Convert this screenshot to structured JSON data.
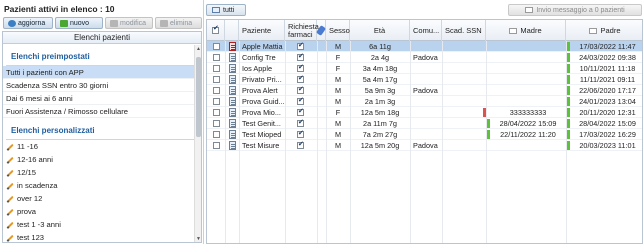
{
  "left": {
    "title": "Pazienti attivi in elenco : 10",
    "toolbar": {
      "aggiorna": "aggiorna",
      "nuovo": "nuovo",
      "modifica": "modifica",
      "elimina": "elimina"
    },
    "list_header": "Elenchi pazienti",
    "preimpostati_title": "Elenchi preimpostati",
    "preimpostati": [
      "Tutti i pazienti con APP",
      "Scadenza SSN entro 30 giorni",
      "Dai 6 mesi ai 6 anni",
      "Fuori Assistenza / Rimosso cellulare"
    ],
    "personalizzati_title": "Elenchi personalizzati",
    "personalizzati": [
      "11 -16",
      "12-16 anni",
      "12/15",
      "in scadenza",
      "over 12",
      "prova",
      "test 1 -3 anni",
      "test 123"
    ]
  },
  "right": {
    "tutti_label": "tutti",
    "invio_label": "Invio messaggio a 0 pazienti",
    "headers": {
      "paziente": "Paziente",
      "richiesta_farmaci": "Richiesta farmaci",
      "sesso": "Sesso",
      "eta": "Età",
      "comune": "Comu...",
      "scad_ssn": "Scad. SSN",
      "madre": "Madre",
      "padre": "Padre"
    },
    "rows": [
      {
        "paziente": "Apple Mattia",
        "farmaci": true,
        "sesso": "M",
        "eta": "6a 11g",
        "comune": "",
        "scad": "",
        "madre": "",
        "padre": "17/03/2022 11:47",
        "selected": true,
        "red": true,
        "scadbar": "",
        "madrebar": "",
        "padrebar": "#5cc13b"
      },
      {
        "paziente": "Config Tre",
        "farmaci": true,
        "sesso": "F",
        "eta": "2a 4g",
        "comune": "Padova",
        "scad": "",
        "madre": "",
        "padre": "24/03/2022 09:38",
        "selected": false,
        "red": false,
        "scadbar": "",
        "madrebar": "",
        "padrebar": "#5cc13b"
      },
      {
        "paziente": "Ios Apple",
        "farmaci": true,
        "sesso": "F",
        "eta": "3a 4m 18g",
        "comune": "",
        "scad": "",
        "madre": "",
        "padre": "10/11/2021 11:18",
        "selected": false,
        "red": false,
        "scadbar": "",
        "madrebar": "",
        "padrebar": "#5cc13b"
      },
      {
        "paziente": "Privato Pri...",
        "farmaci": true,
        "sesso": "M",
        "eta": "5a 4m 17g",
        "comune": "",
        "scad": "",
        "madre": "",
        "padre": "11/11/2021 09:11",
        "selected": false,
        "red": false,
        "scadbar": "",
        "madrebar": "",
        "padrebar": "#5cc13b"
      },
      {
        "paziente": "Prova Alert",
        "farmaci": true,
        "sesso": "M",
        "eta": "5a 9m 3g",
        "comune": "Padova",
        "scad": "",
        "madre": "",
        "padre": "22/06/2020 17:17",
        "selected": false,
        "red": false,
        "scadbar": "",
        "madrebar": "",
        "padrebar": "#5cc13b"
      },
      {
        "paziente": "Prova Guid...",
        "farmaci": true,
        "sesso": "M",
        "eta": "2a 1m 3g",
        "comune": "",
        "scad": "",
        "madre": "",
        "padre": "24/01/2023 13:04",
        "selected": false,
        "red": false,
        "scadbar": "",
        "madrebar": "",
        "padrebar": "#5cc13b"
      },
      {
        "paziente": "Prova Mio...",
        "farmaci": true,
        "sesso": "F",
        "eta": "12a 5m 18g",
        "comune": "",
        "scad": "",
        "madre": "333333333",
        "padre": "20/11/2020 12:31",
        "selected": false,
        "red": false,
        "scadbar": "#d9534f",
        "madrebar": "",
        "padrebar": "#5cc13b"
      },
      {
        "paziente": "Test Genit...",
        "farmaci": true,
        "sesso": "M",
        "eta": "2a 11m 7g",
        "comune": "",
        "scad": "",
        "madre": "28/04/2022 15:09",
        "padre": "28/04/2022 15:09",
        "selected": false,
        "red": false,
        "scadbar": "",
        "madrebar": "#5cc13b",
        "padrebar": "#5cc13b"
      },
      {
        "paziente": "Test Mioped",
        "farmaci": true,
        "sesso": "M",
        "eta": "7a 2m 27g",
        "comune": "",
        "scad": "",
        "madre": "22/11/2022 11:20",
        "padre": "17/03/2022 16:29",
        "selected": false,
        "red": false,
        "scadbar": "",
        "madrebar": "#5cc13b",
        "padrebar": "#5cc13b"
      },
      {
        "paziente": "Test Misure",
        "farmaci": true,
        "sesso": "M",
        "eta": "12a 5m 20g",
        "comune": "Padova",
        "scad": "",
        "madre": "",
        "padre": "20/03/2023 11:01",
        "selected": false,
        "red": false,
        "scadbar": "",
        "madrebar": "",
        "padrebar": "#5cc13b"
      }
    ]
  }
}
